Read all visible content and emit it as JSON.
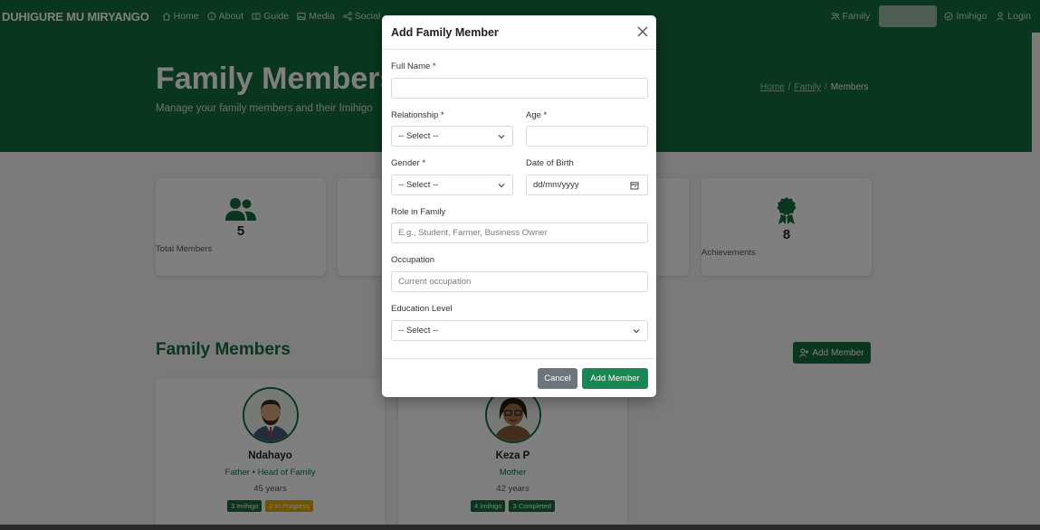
{
  "navbar": {
    "brand": "DUHIGURE MU MIRYANGO",
    "links": [
      {
        "label": "Home",
        "icon": "home-icon"
      },
      {
        "label": "About",
        "icon": "info-icon"
      },
      {
        "label": "Guide",
        "icon": "book-icon"
      },
      {
        "label": "Media",
        "icon": "image-icon"
      },
      {
        "label": "Social",
        "icon": "share-icon"
      }
    ],
    "right": {
      "family": "Family",
      "imihigo": "Imihigo",
      "login": "Login"
    }
  },
  "hero": {
    "title": "Family Members",
    "subtitle": "Manage your family members and their Imihigo",
    "breadcrumb": [
      "Home",
      "Family",
      "Members"
    ]
  },
  "stats": [
    {
      "value": "5",
      "label": "Total Members",
      "icon": "users-icon",
      "color": "#146c3f"
    },
    {
      "value": "8",
      "label": "Achievements",
      "icon": "award-icon",
      "color": "#146c3f"
    }
  ],
  "section": {
    "title": "Family Members",
    "add_button": "Add Member"
  },
  "members": [
    {
      "name": "Ndahayo",
      "role": "Father • Head of Family",
      "age": "45 years",
      "badges": [
        {
          "text": "3 Imihigo",
          "color": "green"
        },
        {
          "text": "2 In Progress",
          "color": "yellow"
        }
      ]
    },
    {
      "name": "Keza P",
      "role": "Mother",
      "age": "42 years",
      "badges": [
        {
          "text": "4 Imihigo",
          "color": "green"
        },
        {
          "text": "3 Completed",
          "color": "green"
        }
      ]
    }
  ],
  "modal": {
    "title": "Add Family Member",
    "full_name_label": "Full Name *",
    "full_name_value": "",
    "relationship_label": "Relationship *",
    "relationship_value": "-- Select --",
    "age_label": "Age *",
    "age_value": "",
    "gender_label": "Gender *",
    "gender_value": "-- Select --",
    "dob_label": "Date of Birth",
    "dob_placeholder": "dd/mm/yyyy",
    "role_label": "Role in Family",
    "role_placeholder": "E.g., Student, Farmer, Business Owner",
    "occupation_label": "Occupation",
    "occupation_placeholder": "Current occupation",
    "education_label": "Education Level",
    "education_value": "-- Select --",
    "cancel": "Cancel",
    "submit": "Add Member"
  }
}
